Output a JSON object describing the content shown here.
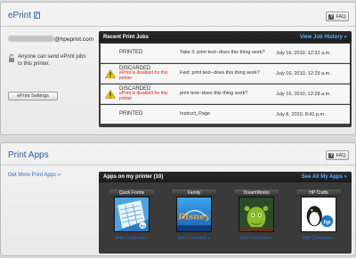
{
  "eprint": {
    "title": "ePrint",
    "faq_label": "FAQ",
    "email_domain": "@hpeprint.com",
    "send_text": "Anyone can send ePrint jobs to this printer.",
    "settings_label": "ePrint Settings",
    "jobs_title": "Recent Print Jobs",
    "history_link": "View Job History »",
    "jobs": [
      {
        "status": "PRINTED",
        "error": "",
        "title": "Take 3: print test--does this thing work?",
        "date": "July 16, 2010, 12:32 a.m.",
        "warning": false
      },
      {
        "status": "DISCARDED",
        "error": "ePrint is disabled for this printer",
        "title": "Fwd: print test--does this thing work?",
        "date": "July 16, 2010, 12:29 a.m.",
        "warning": true
      },
      {
        "status": "DISCARDED",
        "error": "ePrint is disabled for this printer",
        "title": "print test--does this thing work?",
        "date": "July 16, 2010, 12:28 a.m.",
        "warning": true
      },
      {
        "status": "PRINTED",
        "error": "",
        "title": "Instruct_Page",
        "date": "July 8, 2010, 8:41 p.m.",
        "warning": false
      }
    ]
  },
  "apps": {
    "title": "Print Apps",
    "faq_label": "FAQ",
    "more_link": "Get More Print Apps »",
    "box_title": "Apps on my printer (10)",
    "see_all_link": "See All My Apps »",
    "items": [
      {
        "name": "Quick Forms",
        "comment": "Add Comment »"
      },
      {
        "name": "Family",
        "comment": "Add Comment »"
      },
      {
        "name": "DreamWorks",
        "comment": "Add Comment »"
      },
      {
        "name": "HP Crafts",
        "comment": "Add Comment »"
      }
    ]
  }
}
